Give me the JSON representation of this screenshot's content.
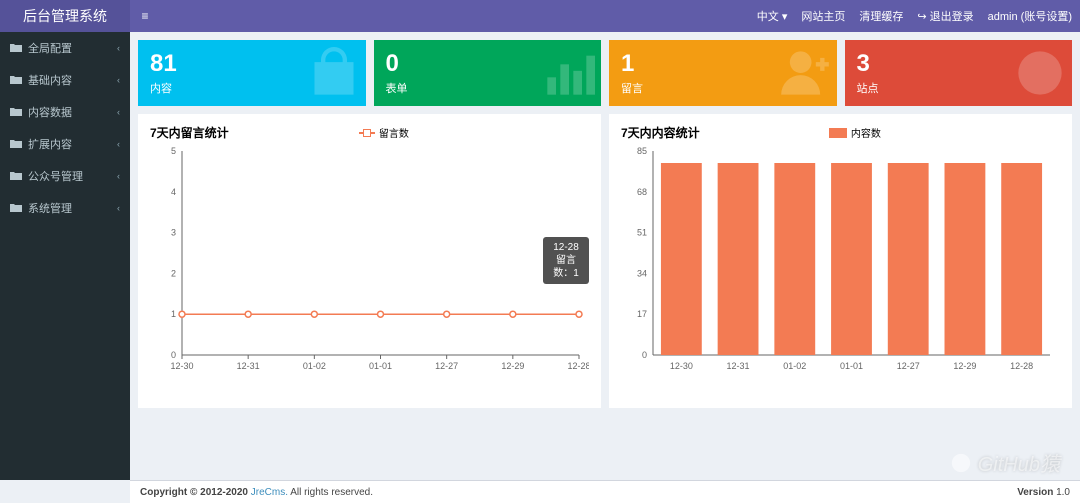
{
  "header": {
    "logo": "后台管理系统",
    "lang": "中文",
    "home": "网站主页",
    "clear": "清理缓存",
    "logout": "退出登录",
    "account": "admin (账号设置)"
  },
  "sidebar": {
    "items": [
      "全局配置",
      "基础内容",
      "内容数据",
      "扩展内容",
      "公众号管理",
      "系统管理"
    ]
  },
  "stats": [
    {
      "num": "81",
      "label": "内容",
      "cls": "c-blue",
      "icon": "bag"
    },
    {
      "num": "0",
      "label": "表单",
      "cls": "c-green",
      "icon": "bars"
    },
    {
      "num": "1",
      "label": "留言",
      "cls": "c-yellow",
      "icon": "user"
    },
    {
      "num": "3",
      "label": "站点",
      "cls": "c-red",
      "icon": "pie"
    }
  ],
  "chart_data": [
    {
      "type": "line",
      "title": "7天内留言统计",
      "legend": "留言数",
      "categories": [
        "12-30",
        "12-31",
        "01-02",
        "01-01",
        "12-27",
        "12-29",
        "12-28"
      ],
      "values": [
        1,
        1,
        1,
        1,
        1,
        1,
        1
      ],
      "ylim": [
        0,
        5
      ],
      "tooltip": {
        "date": "12-28",
        "label": "留言数：1"
      }
    },
    {
      "type": "bar",
      "title": "7天内内容统计",
      "legend": "内容数",
      "categories": [
        "12-30",
        "12-31",
        "01-02",
        "01-01",
        "12-27",
        "12-29",
        "12-28"
      ],
      "values": [
        80,
        80,
        80,
        80,
        80,
        80,
        80
      ],
      "ylim": [
        0,
        85
      ]
    }
  ],
  "colors": {
    "accent": "#f37b53"
  },
  "footer": {
    "left_pre": "Copyright © 2012-2020 ",
    "left_link": "JreCms.",
    "left_post": " All rights reserved.",
    "right_pre": "Version ",
    "right_v": "1.0"
  },
  "watermark": "GitHub猿"
}
